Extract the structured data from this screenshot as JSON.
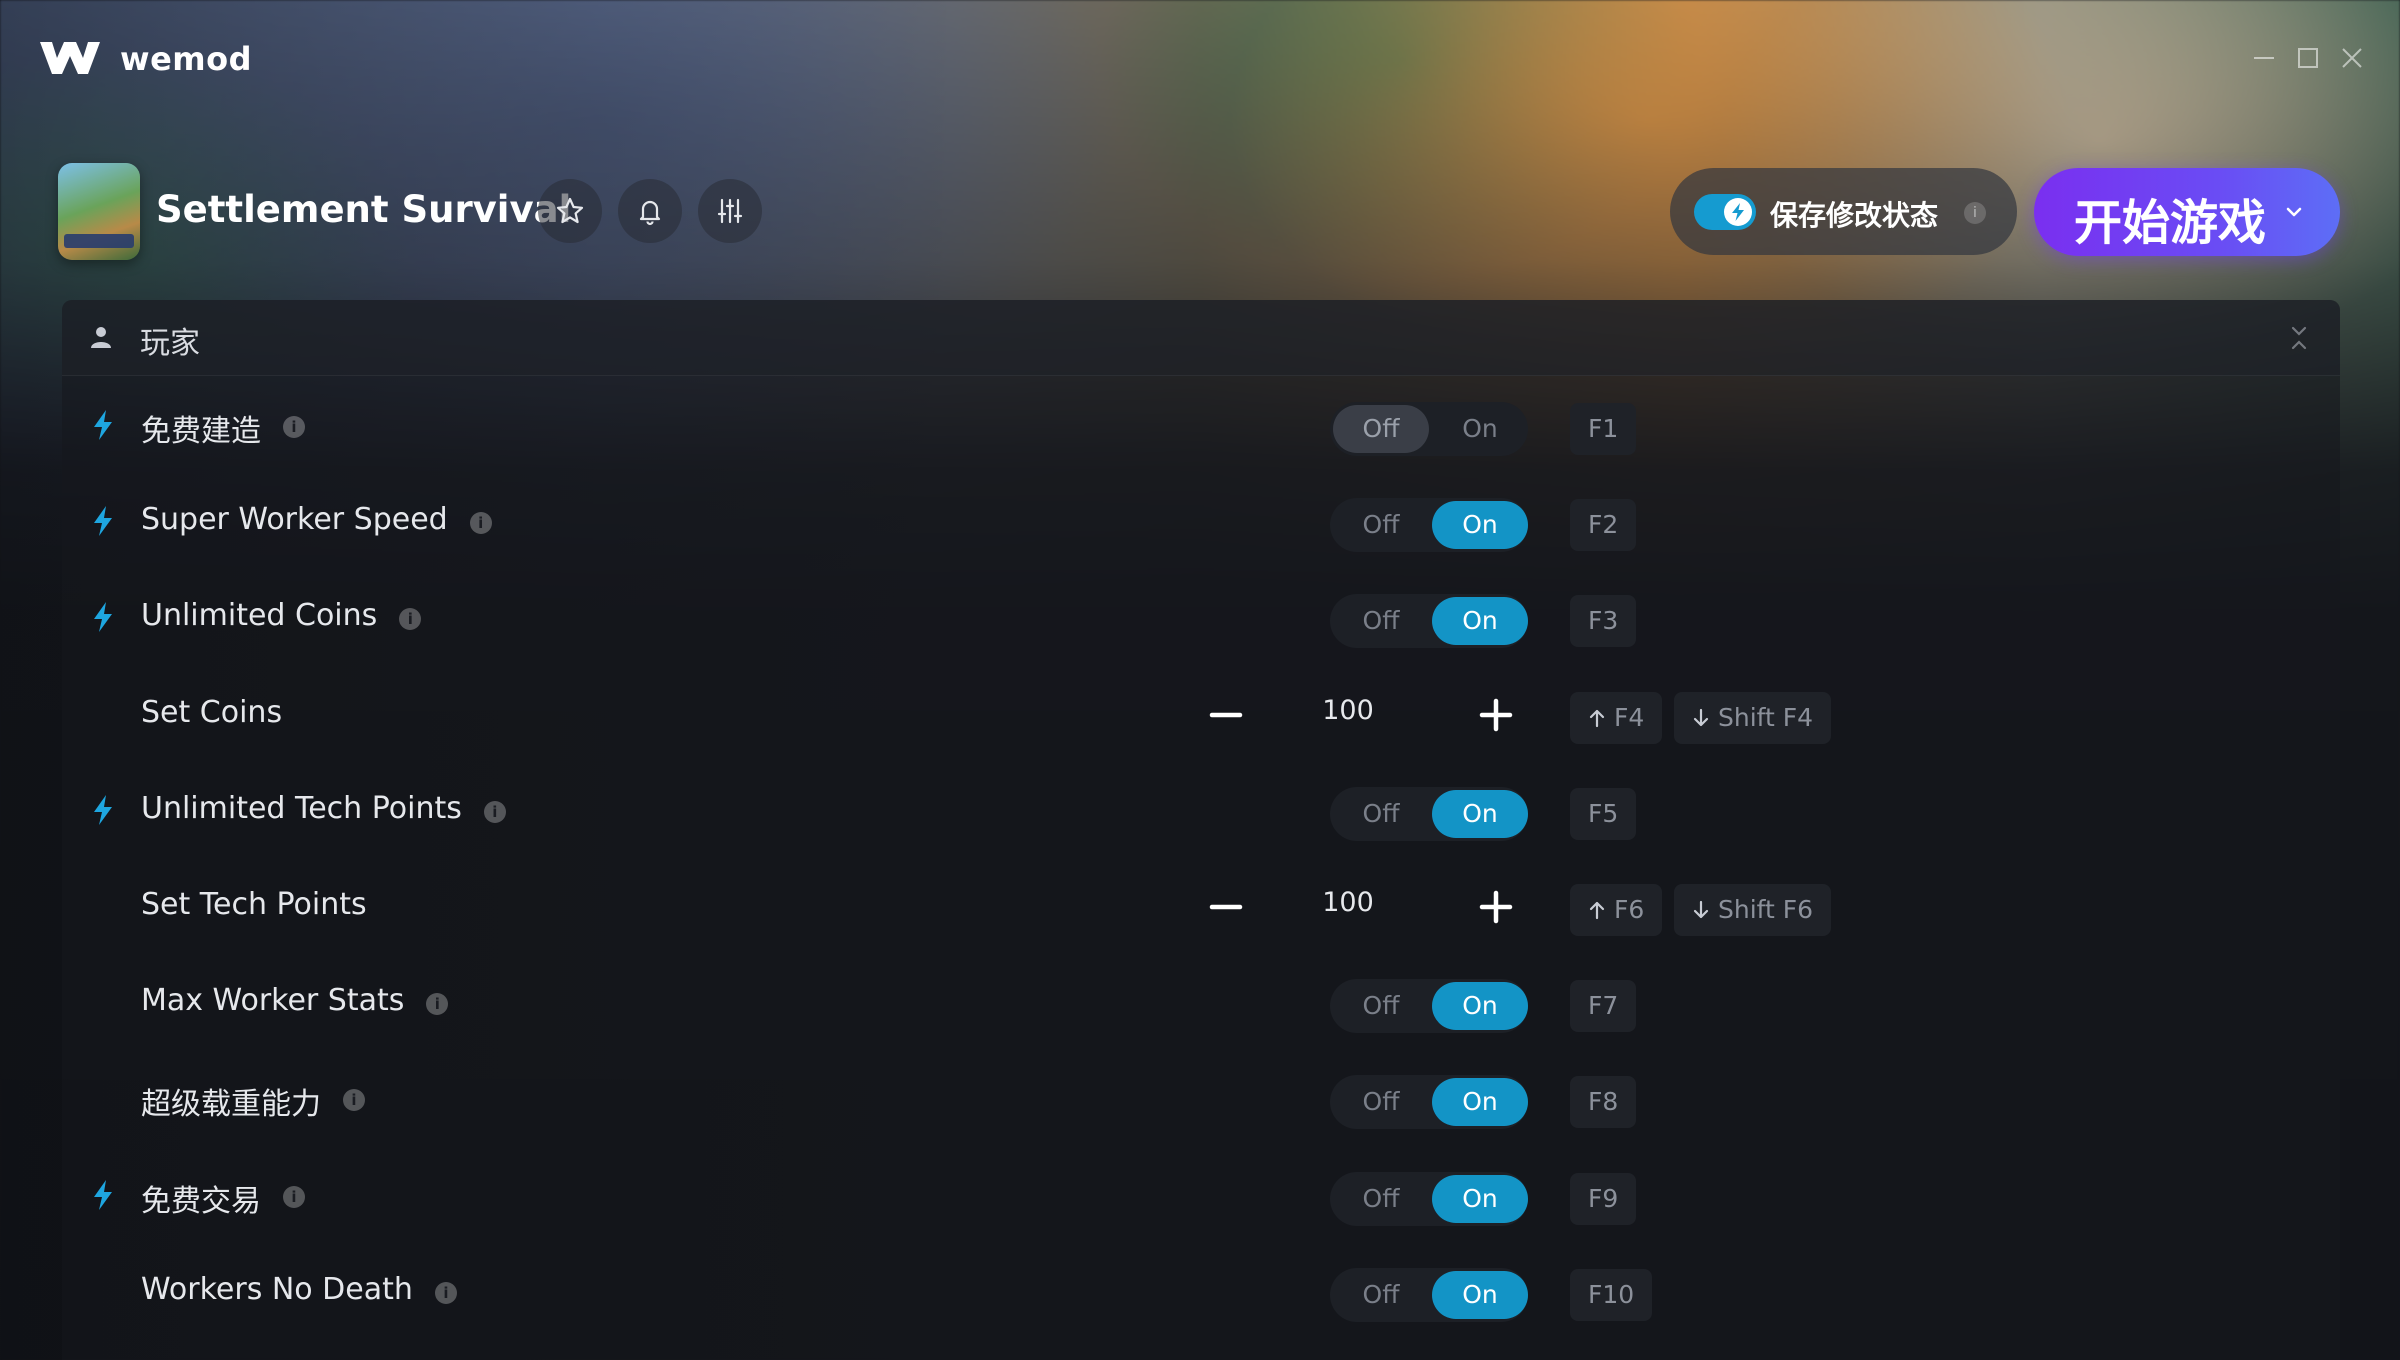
{
  "app": {
    "brand": "wemod"
  },
  "game": {
    "title": "Settlement Survival"
  },
  "save_mods": {
    "label": "保存修改状态",
    "info": "i",
    "enabled": true
  },
  "play_button": {
    "label": "开始游戏"
  },
  "section": {
    "title": "玩家"
  },
  "colors": {
    "accent_on": "#1394c6",
    "play_gradient_start": "#7a2ff0",
    "play_gradient_end": "#5d6ef6",
    "bolt": "#1ea6e0"
  },
  "cheats": [
    {
      "label": "免费建造",
      "type": "toggle",
      "bolt": true,
      "info": true,
      "state": "Off",
      "off_label": "Off",
      "on_label": "On",
      "keys": [
        "F1"
      ]
    },
    {
      "label": "Super Worker Speed",
      "type": "toggle",
      "bolt": true,
      "info": true,
      "state": "On",
      "off_label": "Off",
      "on_label": "On",
      "keys": [
        "F2"
      ]
    },
    {
      "label": "Unlimited Coins",
      "type": "toggle",
      "bolt": true,
      "info": true,
      "state": "On",
      "off_label": "Off",
      "on_label": "On",
      "keys": [
        "F3"
      ]
    },
    {
      "label": "Set Coins",
      "type": "number",
      "bolt": false,
      "info": false,
      "value": "100",
      "keys": [
        "F4",
        "Shift F4"
      ]
    },
    {
      "label": "Unlimited Tech Points",
      "type": "toggle",
      "bolt": true,
      "info": true,
      "state": "On",
      "off_label": "Off",
      "on_label": "On",
      "keys": [
        "F5"
      ]
    },
    {
      "label": "Set Tech Points",
      "type": "number",
      "bolt": false,
      "info": false,
      "value": "100",
      "keys": [
        "F6",
        "Shift F6"
      ]
    },
    {
      "label": "Max Worker Stats",
      "type": "toggle",
      "bolt": false,
      "info": true,
      "state": "On",
      "off_label": "Off",
      "on_label": "On",
      "keys": [
        "F7"
      ]
    },
    {
      "label": "超级载重能力",
      "type": "toggle",
      "bolt": false,
      "info": true,
      "state": "On",
      "off_label": "Off",
      "on_label": "On",
      "keys": [
        "F8"
      ]
    },
    {
      "label": "免费交易",
      "type": "toggle",
      "bolt": true,
      "info": true,
      "state": "On",
      "off_label": "Off",
      "on_label": "On",
      "keys": [
        "F9"
      ]
    },
    {
      "label": "Workers No Death",
      "type": "toggle",
      "bolt": false,
      "info": true,
      "state": "On",
      "off_label": "Off",
      "on_label": "On",
      "keys": [
        "F10"
      ]
    }
  ],
  "icons": {
    "logo": "wemod-logo-icon",
    "favorite": "star-icon",
    "notifications": "bell-icon",
    "settings": "sliders-icon",
    "section": "user-icon",
    "collapse": "collapse-icon",
    "bolt": "bolt-icon",
    "increase_key": "arrow-up-icon",
    "decrease_key": "arrow-down-icon"
  }
}
